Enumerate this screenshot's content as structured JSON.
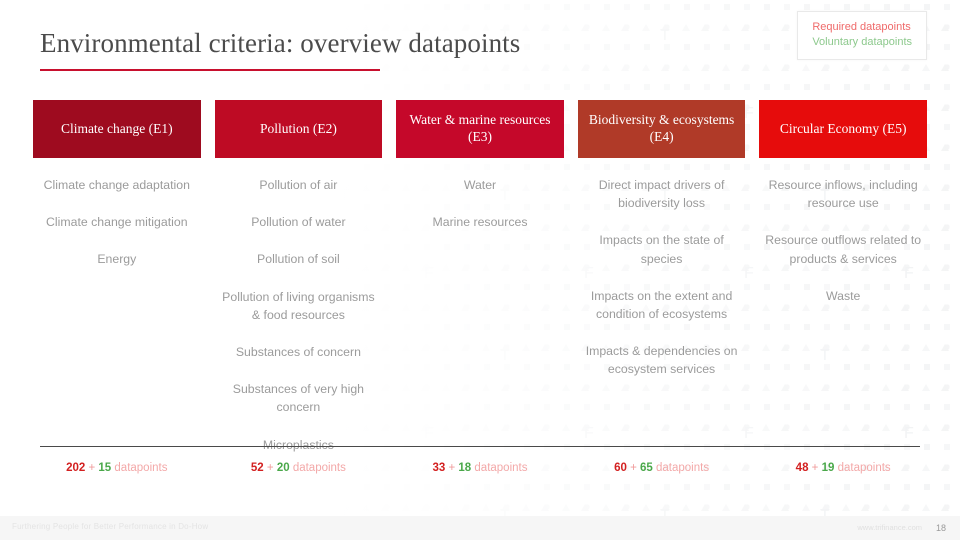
{
  "slide": {
    "title": "Environmental criteria: overview datapoints",
    "page_number": "18"
  },
  "legend": {
    "required_label": "Required datapoints",
    "voluntary_label": "Voluntary datapoints",
    "required_color": "#ef6a6a",
    "voluntary_color": "#8dc98d"
  },
  "columns": [
    {
      "header": "Climate change (E1)",
      "header_color": "#9e0b1f",
      "items": [
        "Climate change adaptation",
        "Climate change mitigation",
        "Energy"
      ],
      "total": {
        "required": "202",
        "plus": "+",
        "voluntary": "15",
        "word": "datapoints"
      }
    },
    {
      "header": "Pollution (E2)",
      "header_color": "#be0b24",
      "items": [
        "Pollution of air",
        "Pollution of water",
        "Pollution of soil",
        "Pollution of living organisms & food resources",
        "Substances of concern",
        "Substances of very high concern",
        "Microplastics"
      ],
      "total": {
        "required": "52",
        "plus": "+",
        "voluntary": "20",
        "word": "datapoints"
      }
    },
    {
      "header": "Water & marine resources (E3)",
      "header_color": "#c5082a",
      "items": [
        "Water",
        "Marine resources"
      ],
      "total": {
        "required": "33",
        "plus": "+",
        "voluntary": "18",
        "word": "datapoints"
      }
    },
    {
      "header": "Biodiversity & ecosystems (E4)",
      "header_color": "#b03a28",
      "items": [
        "Direct impact drivers of biodiversity loss",
        "Impacts on the state of species",
        "Impacts on the extent and condition of ecosystems",
        "Impacts & dependencies on ecosystem services"
      ],
      "total": {
        "required": "60",
        "plus": "+",
        "voluntary": "65",
        "word": "datapoints"
      }
    },
    {
      "header": "Circular Economy (E5)",
      "header_color": "#e60c0c",
      "items": [
        "Resource inflows, including resource use",
        "Resource outflows related to products & services",
        "Waste"
      ],
      "total": {
        "required": "48",
        "plus": "+",
        "voluntary": "19",
        "word": "datapoints"
      }
    }
  ],
  "footer": {
    "tagline": "Furthering People for Better Performance in Do-How",
    "url": "www.trifinance.com"
  }
}
